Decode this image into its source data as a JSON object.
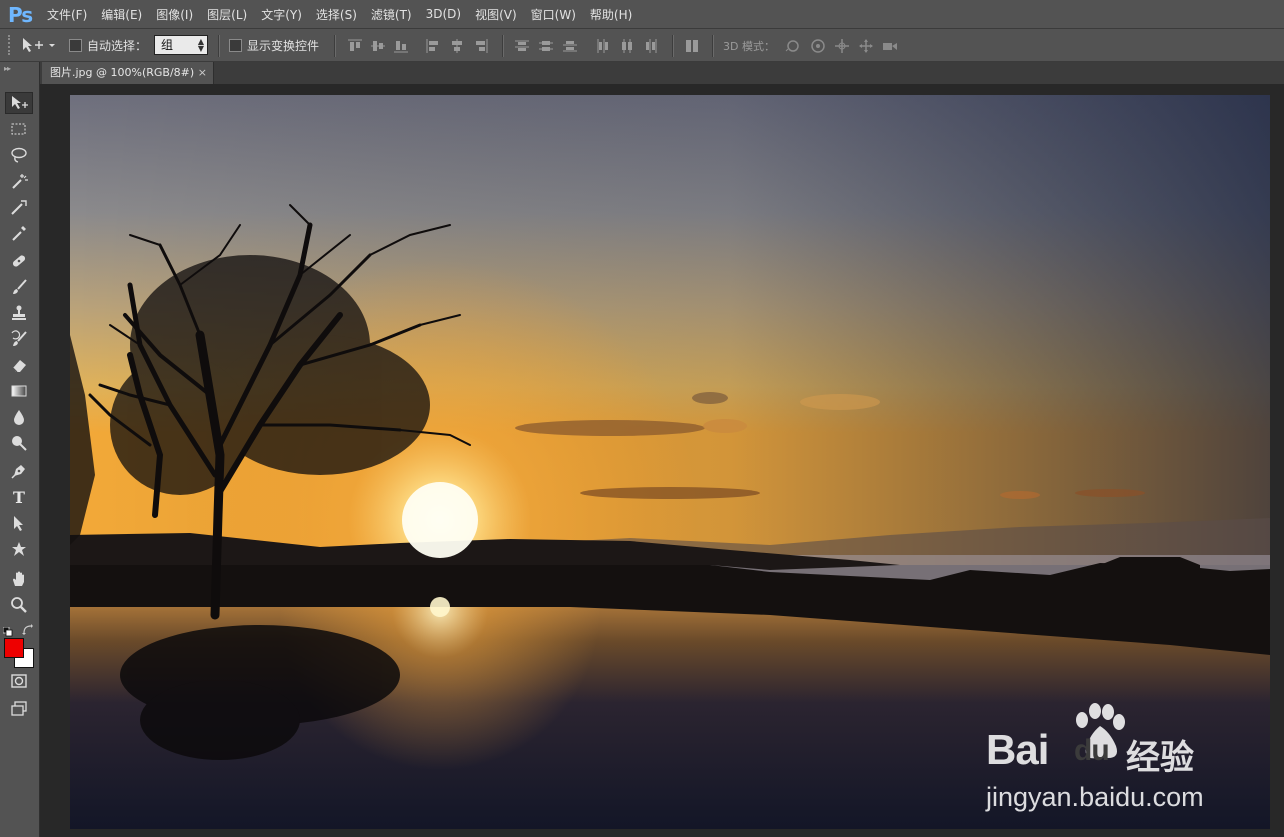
{
  "app": {
    "logo": "Ps"
  },
  "menu": [
    "文件(F)",
    "编辑(E)",
    "图像(I)",
    "图层(L)",
    "文字(Y)",
    "选择(S)",
    "滤镜(T)",
    "3D(D)",
    "视图(V)",
    "窗口(W)",
    "帮助(H)"
  ],
  "options": {
    "auto_select_label": "自动选择：",
    "auto_select_checked": false,
    "group_value": "组",
    "show_transform_label": "显示变换控件",
    "show_transform_checked": false,
    "mode_3d_label": "3D 模式："
  },
  "document": {
    "tab_title": "图片.jpg @ 100%(RGB/8#)",
    "close_glyph": "×"
  },
  "tools": [
    "move-tool",
    "marquee-tool",
    "lasso-tool",
    "magic-wand-tool",
    "crop-tool",
    "eyedropper-tool",
    "healing-brush-tool",
    "brush-tool",
    "clone-stamp-tool",
    "history-brush-tool",
    "eraser-tool",
    "gradient-tool",
    "blur-tool",
    "dodge-tool",
    "pen-tool",
    "type-tool",
    "path-selection-tool",
    "custom-shape-tool",
    "hand-tool",
    "zoom-tool"
  ],
  "type_tool_glyph": "T",
  "colors": {
    "foreground": "#e00000",
    "background": "#ffffff",
    "accent": "#6fb7ff"
  },
  "watermark": {
    "brand_a": "Bai",
    "brand_b": "du",
    "brand_cn": "经验",
    "url": "jingyan.baidu.com"
  }
}
